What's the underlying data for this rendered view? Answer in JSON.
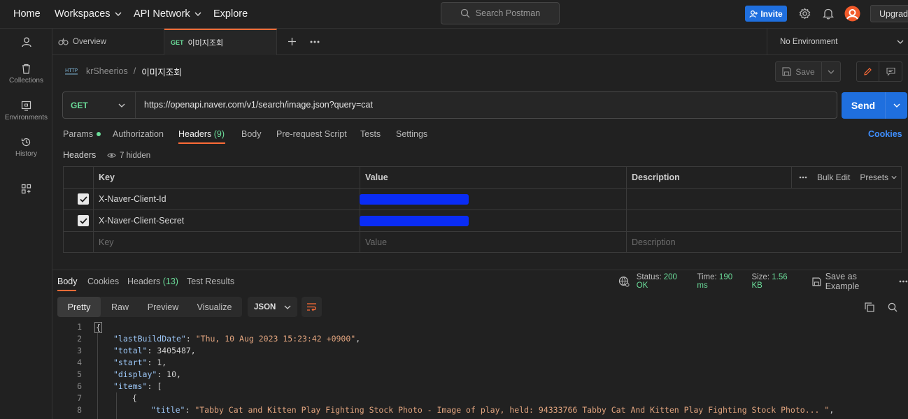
{
  "topbar": {
    "home": "Home",
    "workspaces": "Workspaces",
    "api_network": "API Network",
    "explore": "Explore",
    "search_placeholder": "Search Postman",
    "invite": "Invite",
    "upgrade": "Upgrade"
  },
  "sidebar": {
    "items": [
      {
        "label": ""
      },
      {
        "label": "Collections"
      },
      {
        "label": "Environments"
      },
      {
        "label": "History"
      },
      {
        "label": ""
      }
    ]
  },
  "tabs": {
    "overview": "Overview",
    "active_method": "GET",
    "active_name": "이미지조회",
    "environment": "No Environment"
  },
  "breadcrumb": {
    "collection": "krSheerios",
    "separator": "/",
    "request": "이미지조회",
    "save": "Save"
  },
  "request": {
    "method": "GET",
    "url": "https://openapi.naver.com/v1/search/image.json?query=cat",
    "send": "Send",
    "tabs": [
      {
        "label": "Params"
      },
      {
        "label": "Authorization"
      },
      {
        "label": "Headers",
        "count": "(9)"
      },
      {
        "label": "Body"
      },
      {
        "label": "Pre-request Script"
      },
      {
        "label": "Tests"
      },
      {
        "label": "Settings"
      }
    ],
    "cookies": "Cookies"
  },
  "headers": {
    "label": "Headers",
    "hidden": "7 hidden",
    "columns": {
      "key": "Key",
      "value": "Value",
      "description": "Description"
    },
    "bulk_edit": "Bulk Edit",
    "presets": "Presets",
    "rows": [
      {
        "key": "X-Naver-Client-Id",
        "checked": true
      },
      {
        "key": "X-Naver-Client-Secret",
        "checked": true
      }
    ],
    "placeholders": {
      "key": "Key",
      "value": "Value",
      "description": "Description"
    }
  },
  "response": {
    "tabs": [
      {
        "label": "Body"
      },
      {
        "label": "Cookies"
      },
      {
        "label": "Headers",
        "count": "(13)"
      },
      {
        "label": "Test Results"
      }
    ],
    "status_label": "Status:",
    "status_value": "200 OK",
    "time_label": "Time:",
    "time_value": "190 ms",
    "size_label": "Size:",
    "size_value": "1.56 KB",
    "save_example": "Save as Example",
    "formats": [
      "Pretty",
      "Raw",
      "Preview",
      "Visualize"
    ],
    "language": "JSON"
  },
  "code": {
    "line_numbers": [
      "1",
      "2",
      "3",
      "4",
      "5",
      "6",
      "7",
      "8"
    ],
    "last_build_key": "\"lastBuildDate\"",
    "last_build_val": "\"Thu, 10 Aug 2023 15:23:42 +0900\"",
    "total_key": "\"total\"",
    "total_val": "3405487",
    "start_key": "\"start\"",
    "start_val": "1",
    "display_key": "\"display\"",
    "display_val": "10",
    "items_key": "\"items\"",
    "title_key": "\"title\"",
    "title_val": "\"Tabby Cat and Kitten Play Fighting Stock Photo - Image of play, held: 94333766 Tabby Cat And Kitten Play Fighting Stock Photo... \""
  },
  "colors": {
    "accent": "#1f6fde",
    "orange": "#ff6c37",
    "green": "#6bdd9a",
    "redaction": "#0a2cf5"
  }
}
